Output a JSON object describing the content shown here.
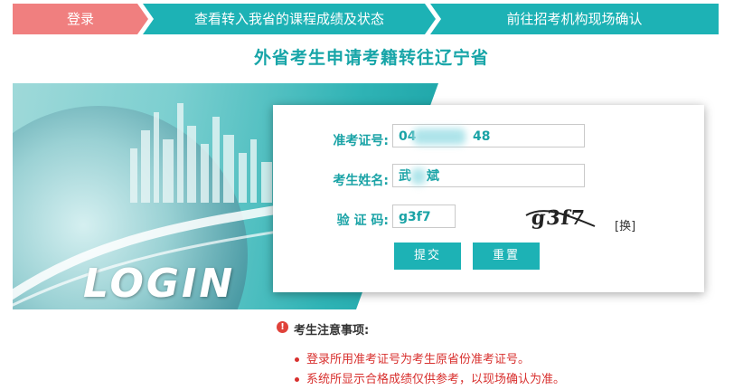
{
  "steps": [
    {
      "label": "登录"
    },
    {
      "label": "查看转入我省的课程成绩及状态"
    },
    {
      "label": "前往招考机构现场确认"
    }
  ],
  "page_title": "外省考生申请考籍转往辽宁省",
  "banner": {
    "login_text": "LOGIN"
  },
  "form": {
    "exam_no_label": "准考证号:",
    "exam_no_value_prefix": "04",
    "exam_no_value_suffix": "48",
    "name_label": "考生姓名:",
    "name_value_first": "武",
    "name_value_last": "斌",
    "captcha_label": "验 证 码:",
    "captcha_value": "g3f7",
    "captcha_image_text": "g3f7",
    "refresh_label": "[换]",
    "submit_label": "提交",
    "reset_label": "重置"
  },
  "notice": {
    "icon": "warning-icon",
    "title": "考生注意事项:",
    "items": [
      "登录所用准考证号为考生原省份准考证号。",
      "系统所显示合格成绩仅供参考，以现场确认为准。"
    ]
  },
  "colors": {
    "teal": "#1db2b5",
    "coral": "#f07f7f",
    "red": "#d8302e"
  }
}
